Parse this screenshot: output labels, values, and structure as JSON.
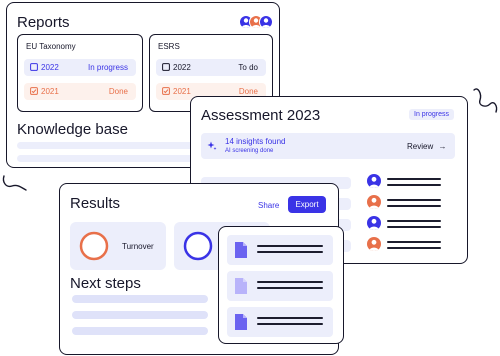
{
  "colors": {
    "accent": "#3a33e6",
    "accent_orange": "#e8704a",
    "ink": "#17172a",
    "lavender": "#eceefb"
  },
  "reports": {
    "title": "Reports",
    "cards": [
      {
        "title": "EU Taxonomy",
        "rows": [
          {
            "year": "2022",
            "status": "In progress",
            "icon": "square-outline-icon"
          },
          {
            "year": "2021",
            "status": "Done",
            "icon": "checked-box-icon"
          }
        ]
      },
      {
        "title": "ESRS",
        "rows": [
          {
            "year": "2022",
            "status": "To do",
            "icon": "square-outline-icon"
          },
          {
            "year": "2021",
            "status": "Done",
            "icon": "checked-box-icon"
          }
        ]
      }
    ],
    "knowledge_base": "Knowledge base"
  },
  "assessment": {
    "title": "Assessment 2023",
    "badge": "In progress",
    "insights": {
      "title": "14 insights found",
      "subtitle": "AI screening done",
      "action": "Review"
    }
  },
  "results": {
    "title": "Results",
    "share": "Share",
    "export": "Export",
    "tiles": [
      {
        "label": "Turnover"
      }
    ],
    "next_steps": "Next steps"
  }
}
